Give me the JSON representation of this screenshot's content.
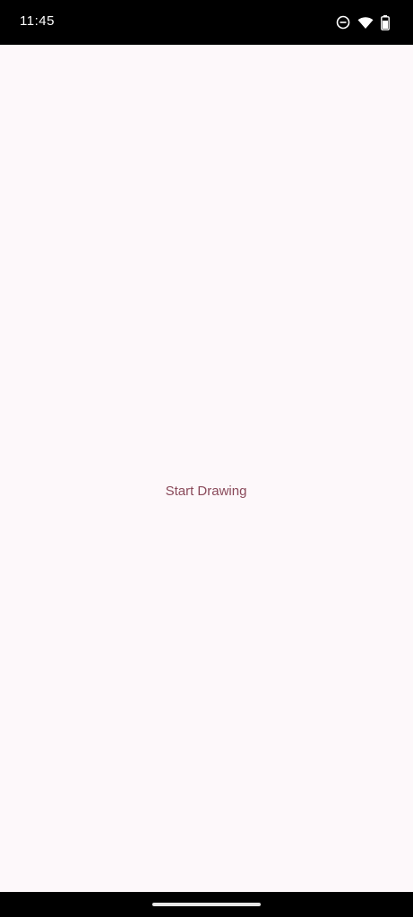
{
  "status_bar": {
    "time": "11:45",
    "icons": [
      "do-not-disturb-icon",
      "wifi-icon",
      "battery-icon"
    ]
  },
  "main": {
    "start_button_label": "Start Drawing"
  },
  "colors": {
    "background": "#fdf8fa",
    "button_text": "#8a4a5a",
    "system_bars": "#000000"
  }
}
